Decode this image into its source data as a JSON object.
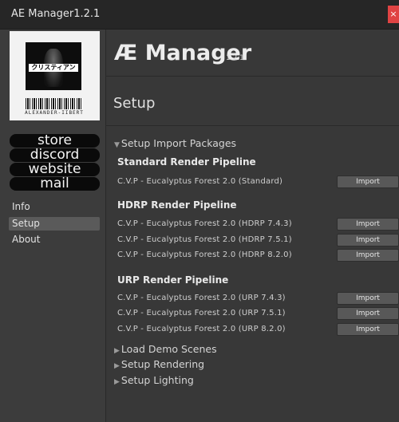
{
  "window": {
    "title": "AE Manager1.2.1",
    "close_label": "×"
  },
  "sidebar": {
    "logo": {
      "tag_text": "クリスティアン",
      "barcode_text": "ALEXANDER-IIBERT"
    },
    "links": [
      {
        "label": "store"
      },
      {
        "label": "discord"
      },
      {
        "label": "website"
      },
      {
        "label": "mail"
      }
    ],
    "nav": [
      {
        "label": "Info",
        "active": false
      },
      {
        "label": "Setup",
        "active": true
      },
      {
        "label": "About",
        "active": false
      }
    ]
  },
  "header": {
    "title": "Æ Manager",
    "version": "1.2.1"
  },
  "page": {
    "heading": "Setup"
  },
  "setup": {
    "import_foldout": "Setup Import Packages",
    "import_button_label": "Import",
    "standard": {
      "title": "Standard Render Pipeline",
      "packages": [
        "C.V.P - Eucalyptus Forest 2.0 (Standard)"
      ]
    },
    "hdrp": {
      "title": "HDRP Render Pipeline",
      "packages": [
        "C.V.P - Eucalyptus Forest 2.0 (HDRP 7.4.3)",
        "C.V.P - Eucalyptus Forest 2.0 (HDRP 7.5.1)",
        "C.V.P - Eucalyptus Forest 2.0 (HDRP 8.2.0)"
      ]
    },
    "urp": {
      "title": "URP Render Pipeline",
      "packages": [
        "C.V.P - Eucalyptus Forest 2.0 (URP 7.4.3)",
        "C.V.P - Eucalyptus Forest 2.0 (URP 7.5.1)",
        "C.V.P - Eucalyptus Forest 2.0 (URP 8.2.0)"
      ]
    },
    "foldouts": [
      {
        "label": "Load Demo Scenes"
      },
      {
        "label": "Setup Rendering"
      },
      {
        "label": "Setup Lighting"
      }
    ]
  },
  "colors": {
    "background": "#383838",
    "titlebar": "#262626",
    "close_button": "#e04343",
    "active_nav": "#5a5a5a",
    "button": "#585858"
  }
}
